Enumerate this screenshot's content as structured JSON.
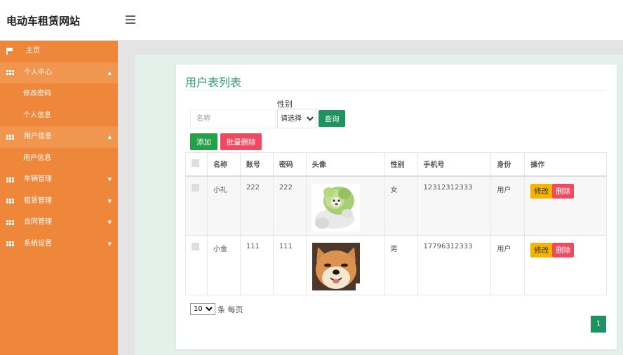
{
  "app": {
    "title": "电动车租赁网站"
  },
  "sidebar": {
    "items": [
      {
        "label": "主页",
        "icon": "flag-icon"
      },
      {
        "label": "个人中心",
        "icon": "grid-icon",
        "arrow": "▲",
        "children": [
          "修改密码",
          "个人信息"
        ]
      },
      {
        "label": "用户信息",
        "icon": "grid-icon",
        "arrow": "▲",
        "children": [
          "用户信息"
        ]
      },
      {
        "label": "车辆管理",
        "icon": "grid-icon",
        "arrow": "▼"
      },
      {
        "label": "租赁管理",
        "icon": "grid-icon",
        "arrow": "▼"
      },
      {
        "label": "合同管理",
        "icon": "grid-icon",
        "arrow": "▼"
      },
      {
        "label": "系统设置",
        "icon": "grid-icon",
        "arrow": "▼"
      }
    ]
  },
  "main": {
    "title": "用户表列表",
    "filters": {
      "name_placeholder": "名称",
      "gender_label": "性别",
      "gender_selected": "请选择",
      "search_label": "查询"
    },
    "actions": {
      "add_label": "添加",
      "batch_delete_label": "批量删除"
    },
    "table": {
      "headers": [
        "名称",
        "账号",
        "密码",
        "头像",
        "性别",
        "手机号",
        "身份",
        "操作"
      ],
      "rows": [
        {
          "name": "小礼",
          "account": "222",
          "password": "222",
          "avatar": "cabbage-dog-avatar",
          "gender": "女",
          "phone": "12312312333",
          "role": "用户",
          "edit": "修改",
          "delete": "删除"
        },
        {
          "name": "小金",
          "account": "111",
          "password": "111",
          "avatar": "shiba-dog-avatar",
          "gender": "男",
          "phone": "17796312333",
          "role": "用户",
          "edit": "修改",
          "delete": "删除"
        }
      ]
    },
    "pagination": {
      "page_size": "10",
      "page_size_text": "条 每页",
      "current_page": "1"
    }
  },
  "colors": {
    "sidebar": "#ee873a",
    "accent": "#1d9361",
    "title": "#2da16a",
    "danger": "#ef4a5f",
    "warning": "#f6b400"
  }
}
